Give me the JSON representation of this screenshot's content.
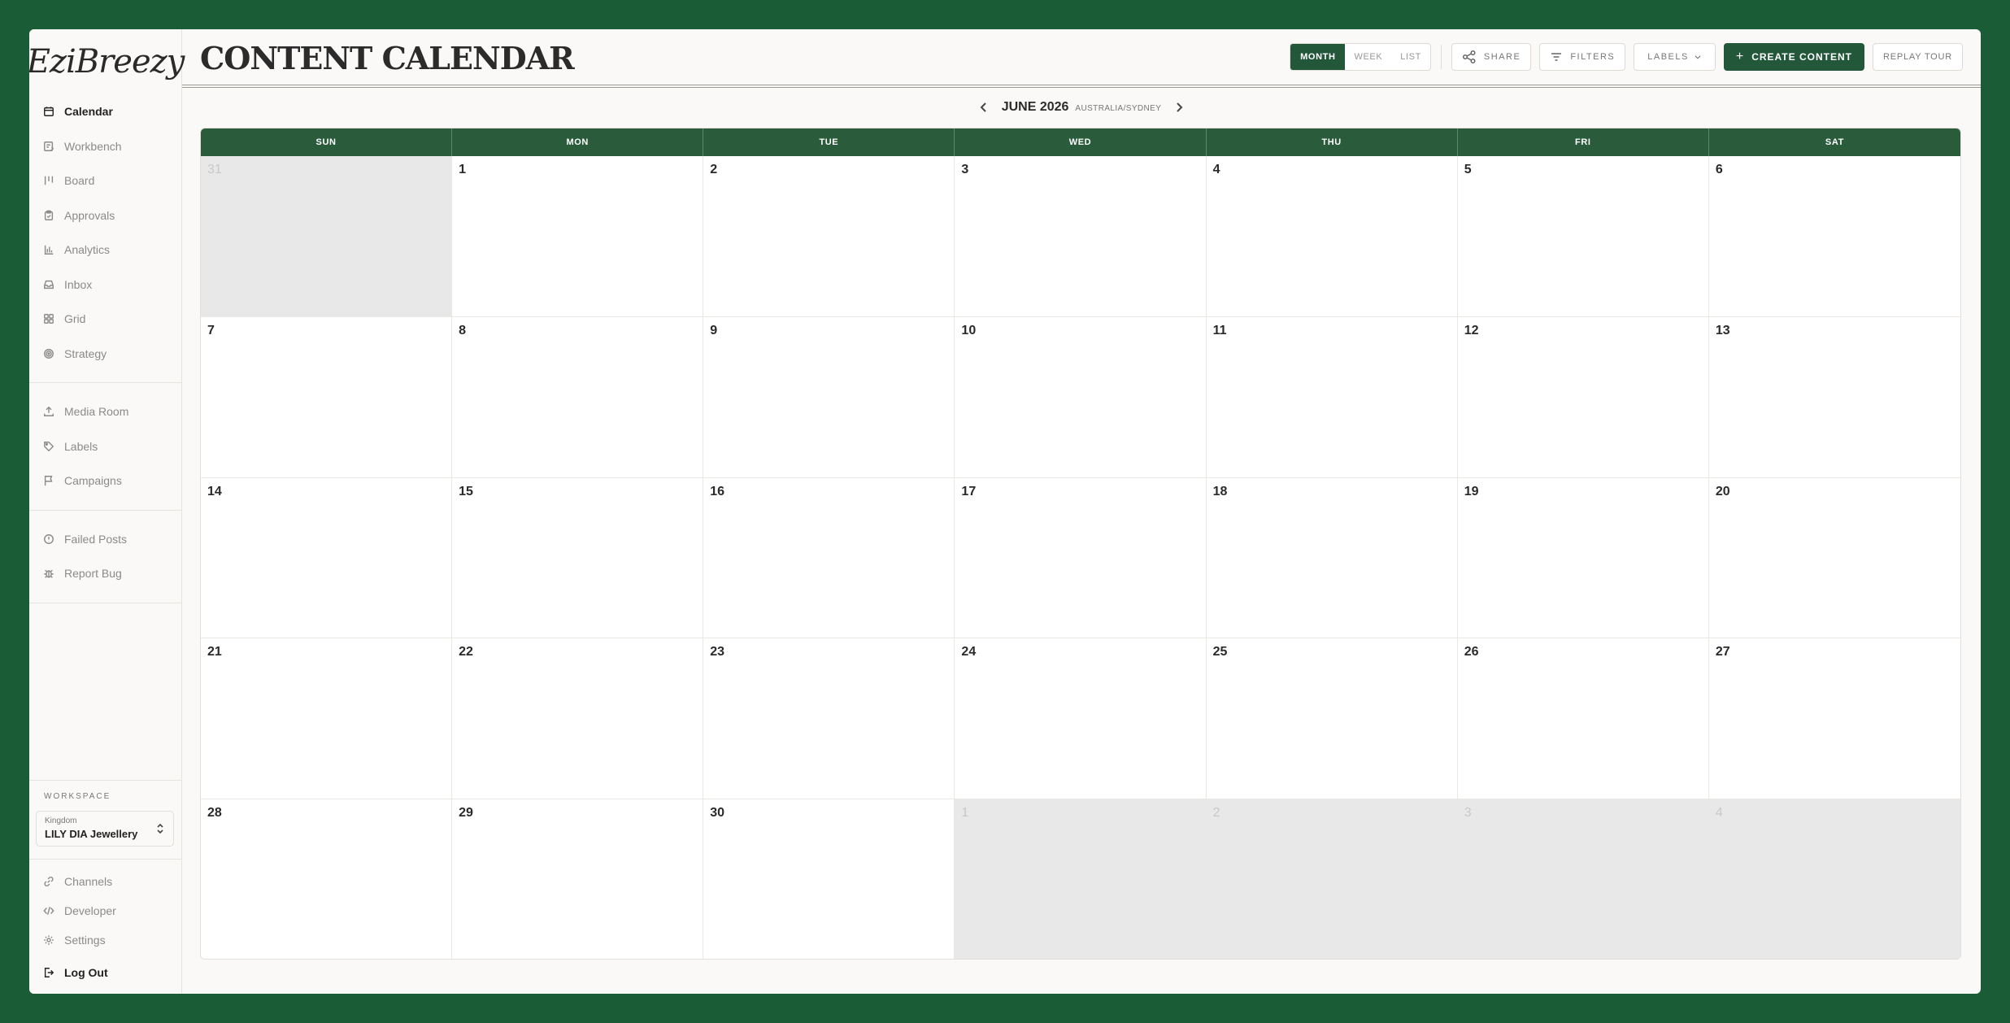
{
  "brand": {
    "logo_text": "EziBreezy"
  },
  "sidebar": {
    "primary": [
      {
        "label": "Calendar",
        "icon": "calendar-icon",
        "active": true
      },
      {
        "label": "Workbench",
        "icon": "workbench-icon"
      },
      {
        "label": "Board",
        "icon": "board-icon"
      },
      {
        "label": "Approvals",
        "icon": "clipboard-icon"
      },
      {
        "label": "Analytics",
        "icon": "bar-chart-icon"
      },
      {
        "label": "Inbox",
        "icon": "inbox-icon"
      },
      {
        "label": "Grid",
        "icon": "grid-icon"
      },
      {
        "label": "Strategy",
        "icon": "target-icon"
      }
    ],
    "secondary": [
      {
        "label": "Media Room",
        "icon": "upload-icon"
      },
      {
        "label": "Labels",
        "icon": "tag-icon"
      },
      {
        "label": "Campaigns",
        "icon": "flag-icon"
      }
    ],
    "tertiary": [
      {
        "label": "Failed Posts",
        "icon": "alert-circle-icon"
      },
      {
        "label": "Report Bug",
        "icon": "bug-icon"
      }
    ],
    "workspace": {
      "heading": "WORKSPACE",
      "org": "Kingdom",
      "name": "LILY DIA Jewellery"
    },
    "bottom": [
      {
        "label": "Channels",
        "icon": "link-icon"
      },
      {
        "label": "Developer",
        "icon": "code-icon"
      },
      {
        "label": "Settings",
        "icon": "gear-icon"
      }
    ],
    "logout": {
      "label": "Log Out",
      "icon": "logout-icon"
    }
  },
  "header": {
    "title": "CONTENT CALENDAR",
    "views": [
      "MONTH",
      "WEEK",
      "LIST"
    ],
    "active_view": "MONTH",
    "share_label": "SHARE",
    "filters_label": "FILTERS",
    "labels_label": "LABELS",
    "create_label": "CREATE CONTENT",
    "replay_label": "REPLAY TOUR"
  },
  "calendar": {
    "month_label": "JUNE 2026",
    "timezone": "AUSTRALIA/SYDNEY",
    "weekdays": [
      "SUN",
      "MON",
      "TUE",
      "WED",
      "THU",
      "FRI",
      "SAT"
    ],
    "days": [
      {
        "n": "31",
        "other": true
      },
      {
        "n": "1"
      },
      {
        "n": "2"
      },
      {
        "n": "3"
      },
      {
        "n": "4"
      },
      {
        "n": "5"
      },
      {
        "n": "6"
      },
      {
        "n": "7"
      },
      {
        "n": "8"
      },
      {
        "n": "9"
      },
      {
        "n": "10"
      },
      {
        "n": "11"
      },
      {
        "n": "12"
      },
      {
        "n": "13"
      },
      {
        "n": "14"
      },
      {
        "n": "15"
      },
      {
        "n": "16"
      },
      {
        "n": "17"
      },
      {
        "n": "18"
      },
      {
        "n": "19"
      },
      {
        "n": "20"
      },
      {
        "n": "21"
      },
      {
        "n": "22"
      },
      {
        "n": "23"
      },
      {
        "n": "24"
      },
      {
        "n": "25"
      },
      {
        "n": "26"
      },
      {
        "n": "27"
      },
      {
        "n": "28"
      },
      {
        "n": "29"
      },
      {
        "n": "30"
      },
      {
        "n": "1",
        "other": true
      },
      {
        "n": "2",
        "other": true
      },
      {
        "n": "3",
        "other": true
      },
      {
        "n": "4",
        "other": true
      }
    ]
  },
  "colors": {
    "brand_green": "#22573a",
    "frame_green": "#1a5c36",
    "outside_month": "#e8e8e8"
  }
}
